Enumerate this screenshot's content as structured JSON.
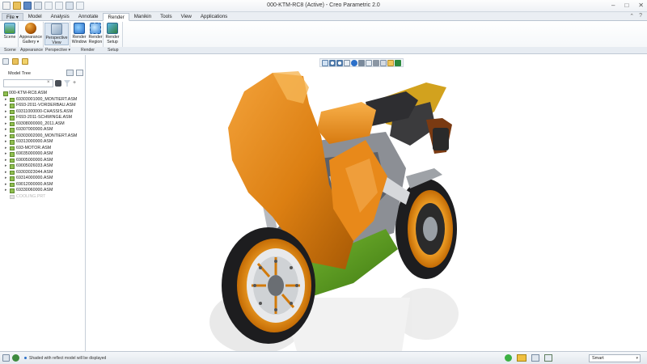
{
  "window": {
    "title": "000-KTM-RC8 (Active) - Creo Parametric 2.0",
    "controls": [
      "minimize",
      "maximize",
      "close"
    ]
  },
  "ribbon": {
    "tabs": [
      {
        "label": "File ▾"
      },
      {
        "label": "Model"
      },
      {
        "label": "Analysis"
      },
      {
        "label": "Annotate"
      },
      {
        "label": "Render"
      },
      {
        "label": "Manikin"
      },
      {
        "label": "Tools"
      },
      {
        "label": "View"
      },
      {
        "label": "Applications"
      }
    ],
    "active_tab": "Render",
    "buttons": {
      "scene": "Scene",
      "appearance_gallery_1": "Appearance",
      "appearance_gallery_2": "Gallery ▾",
      "perspective_view_1": "Perspective",
      "perspective_view_2": "View",
      "render_window_1": "Render",
      "render_window_2": "Window",
      "render_region_1": "Render",
      "render_region_2": "Region",
      "render_setup_1": "Render",
      "render_setup_2": "Setup"
    },
    "groups": {
      "scene": "Scene",
      "appearance": "Appearance",
      "perspective": "Perspective ▾",
      "render": "Render",
      "setup": "Setup"
    }
  },
  "model_tree": {
    "header": "Model Tree",
    "search_placeholder": "",
    "root": "000-KTM-RC8.ASM",
    "items": [
      {
        "label": "69303001000_MONTIERT.ASM",
        "dim": false
      },
      {
        "label": "F693-2011-VORDERBAU.ASM",
        "dim": false
      },
      {
        "label": "69311000000-CHASSIS.ASM",
        "dim": false
      },
      {
        "label": "F693-2011-SCHWINGE.ASM",
        "dim": false
      },
      {
        "label": "69308000000_2011.ASM",
        "dim": false
      },
      {
        "label": "69307000000.ASM",
        "dim": false
      },
      {
        "label": "69303002000_MONTIERT.ASM",
        "dim": false
      },
      {
        "label": "69313000000.ASM",
        "dim": false
      },
      {
        "label": "693-MOTOR.ASM",
        "dim": false
      },
      {
        "label": "69035000000.ASM",
        "dim": false
      },
      {
        "label": "69005000000.ASM",
        "dim": false
      },
      {
        "label": "69005026033.ASM",
        "dim": false
      },
      {
        "label": "69303023044.ASM",
        "dim": false
      },
      {
        "label": "69314000000.ASM",
        "dim": false
      },
      {
        "label": "69012000000.ASM",
        "dim": false
      },
      {
        "label": "69330060000.ASM",
        "dim": false
      },
      {
        "label": "COOLING.PRT",
        "dim": true
      }
    ]
  },
  "status": {
    "message": "Shaded with reflect model will be displayed",
    "filter_value": "Smart"
  },
  "colors": {
    "fairing_orange": "#e08a14",
    "rim_orange": "#f0921c",
    "belly_green": "#5a9a1f",
    "tire_black": "#1d1d1f",
    "accent_blue": "#2a6fc9"
  }
}
